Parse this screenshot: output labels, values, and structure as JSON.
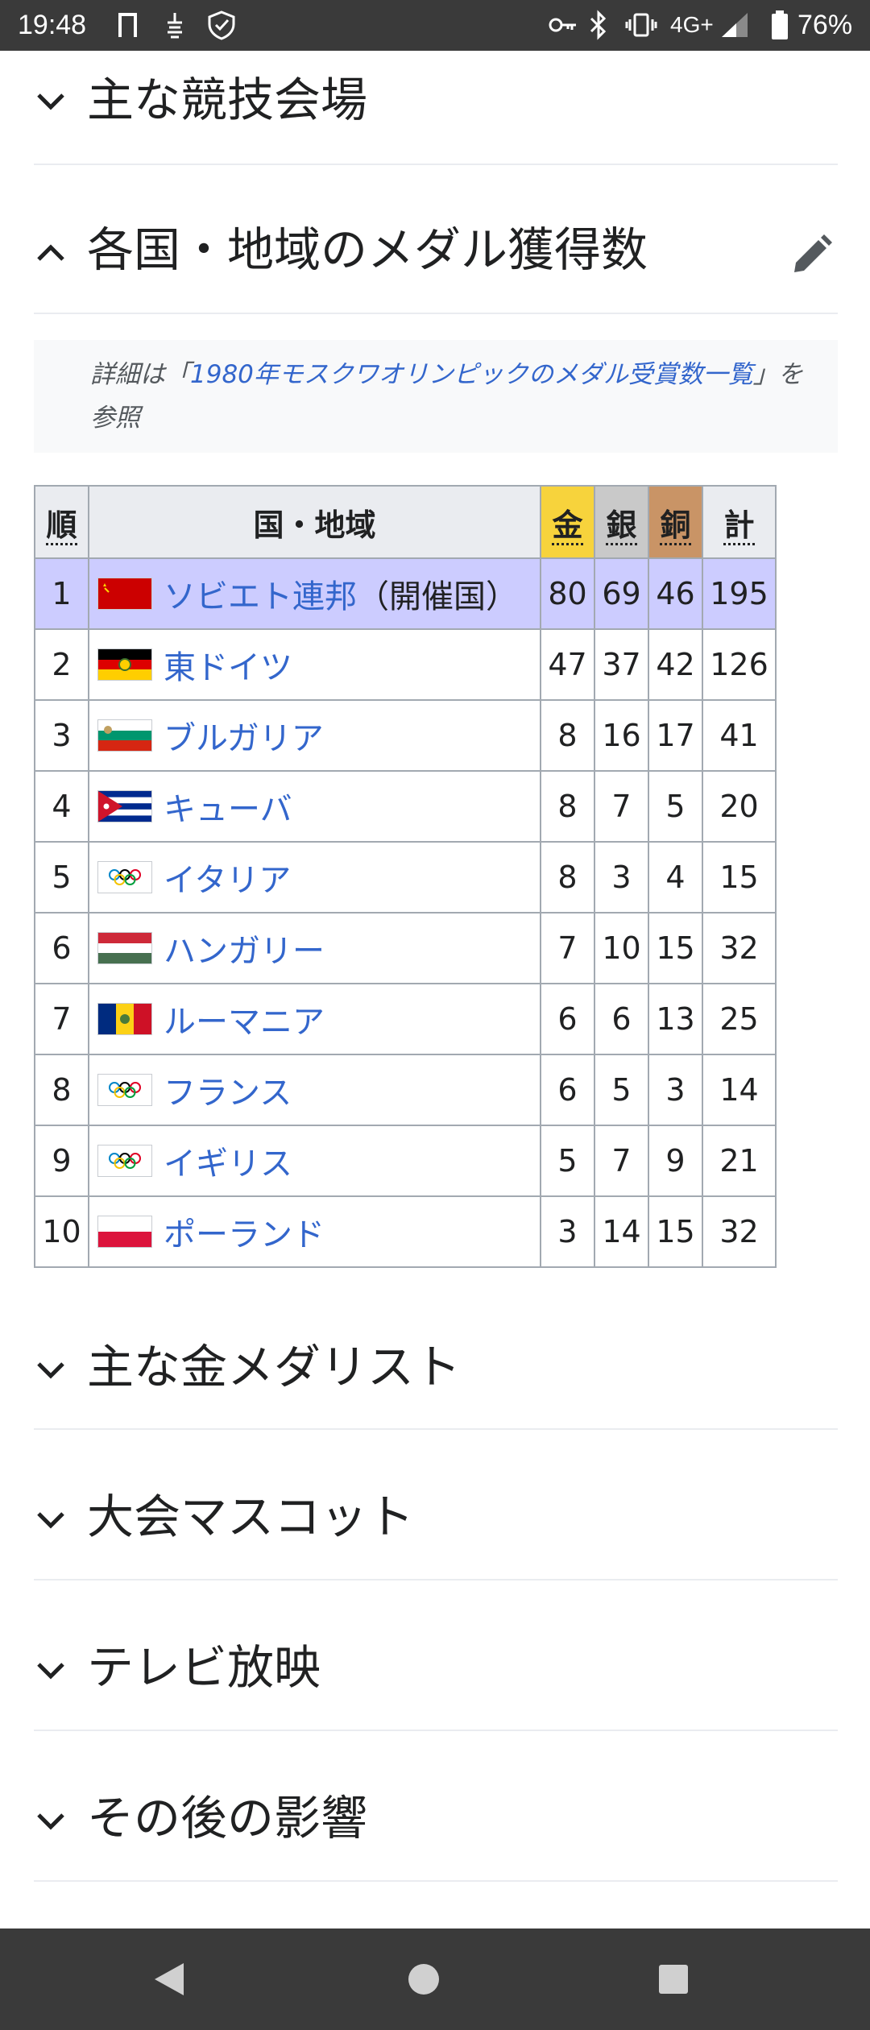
{
  "status_bar": {
    "time": "19:48",
    "network": "4G+",
    "battery": "76%"
  },
  "sections_top": [
    {
      "title": "主な競技会場",
      "expanded": false
    }
  ],
  "medal_section": {
    "title": "各国・地域のメダル獲得数",
    "expanded": true,
    "hatnote_prefix": "詳細は「",
    "hatnote_link": "1980年モスクワオリンピックのメダル受賞数一覧",
    "hatnote_suffix": "」を参照"
  },
  "table": {
    "headers": {
      "rank": "順",
      "nation": "国・地域",
      "gold": "金",
      "silver": "銀",
      "bronze": "銅",
      "total": "計"
    },
    "host_note": "（開催国）",
    "rows": [
      {
        "rank": "1",
        "nation": "ソビエト連邦",
        "flag": "flag-ussr",
        "gold": "80",
        "silver": "69",
        "bronze": "46",
        "total": "195"
      },
      {
        "rank": "2",
        "nation": "東ドイツ",
        "flag": "flag-east-germany",
        "gold": "47",
        "silver": "37",
        "bronze": "42",
        "total": "126"
      },
      {
        "rank": "3",
        "nation": "ブルガリア",
        "flag": "flag-bulgaria",
        "gold": "8",
        "silver": "16",
        "bronze": "17",
        "total": "41"
      },
      {
        "rank": "4",
        "nation": "キューバ",
        "flag": "flag-cuba",
        "gold": "8",
        "silver": "7",
        "bronze": "5",
        "total": "20"
      },
      {
        "rank": "5",
        "nation": "イタリア",
        "flag": "flag-olympic",
        "gold": "8",
        "silver": "3",
        "bronze": "4",
        "total": "15"
      },
      {
        "rank": "6",
        "nation": "ハンガリー",
        "flag": "flag-hungary",
        "gold": "7",
        "silver": "10",
        "bronze": "15",
        "total": "32"
      },
      {
        "rank": "7",
        "nation": "ルーマニア",
        "flag": "flag-romania",
        "gold": "6",
        "silver": "6",
        "bronze": "13",
        "total": "25"
      },
      {
        "rank": "8",
        "nation": "フランス",
        "flag": "flag-olympic",
        "gold": "6",
        "silver": "5",
        "bronze": "3",
        "total": "14"
      },
      {
        "rank": "9",
        "nation": "イギリス",
        "flag": "flag-olympic",
        "gold": "5",
        "silver": "7",
        "bronze": "9",
        "total": "21"
      },
      {
        "rank": "10",
        "nation": "ポーランド",
        "flag": "flag-poland",
        "gold": "3",
        "silver": "14",
        "bronze": "15",
        "total": "32"
      }
    ]
  },
  "sections_bottom": [
    {
      "title": "主な金メダリスト",
      "expanded": false
    },
    {
      "title": "大会マスコット",
      "expanded": false
    },
    {
      "title": "テレビ放映",
      "expanded": false
    },
    {
      "title": "その後の影響",
      "expanded": false
    }
  ],
  "colors": {
    "link": "#3366cc",
    "host_row": "#ccccff",
    "gold": "#f7d33c",
    "silver": "#c9c9c9",
    "bronze": "#c99466",
    "nav_bar": "#3a3a3a"
  },
  "icons": [
    "chevron-down-icon",
    "chevron-up-icon",
    "edit-pencil-icon",
    "back-icon",
    "home-icon",
    "recents-icon"
  ]
}
